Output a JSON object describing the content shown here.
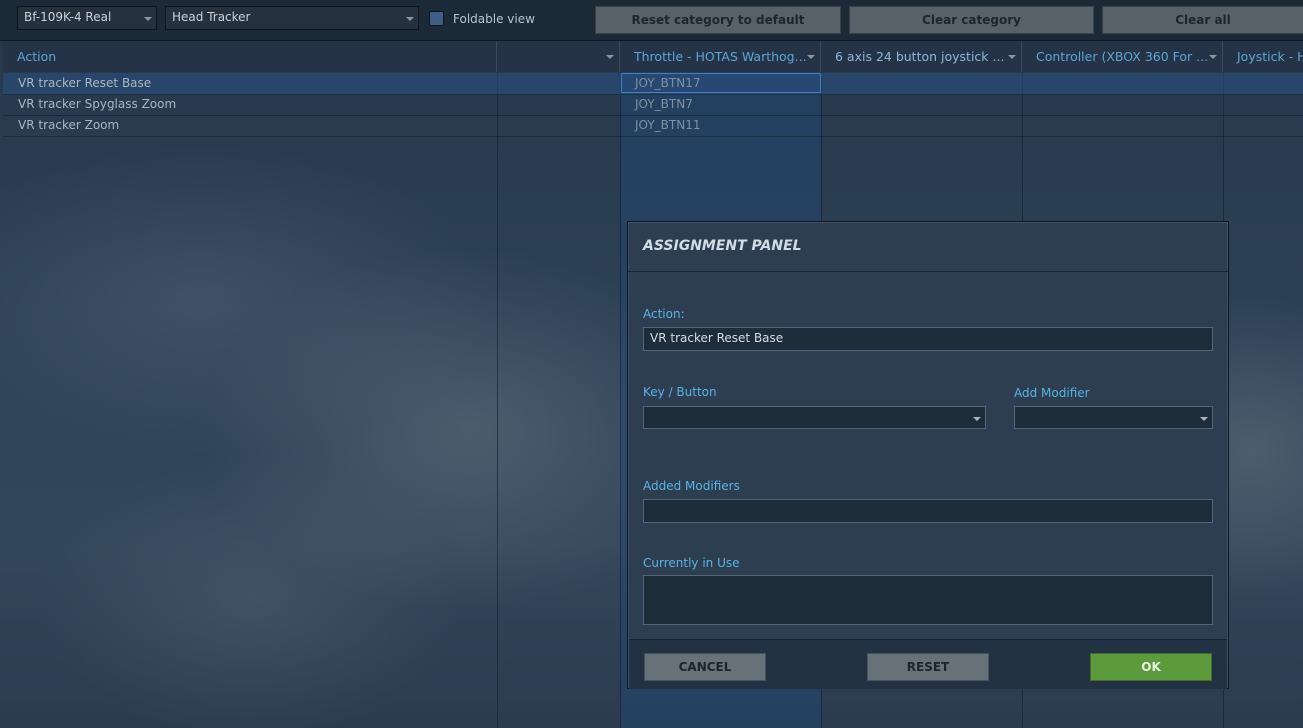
{
  "toolbar": {
    "aircraft_select": "Bf-109K-4 Real",
    "category_select": "Head Tracker",
    "foldable_label": "Foldable view",
    "reset_category_label": "Reset category to default",
    "clear_category_label": "Clear category",
    "clear_all_label": "Clear all"
  },
  "table": {
    "columns": [
      "Action",
      "",
      "Throttle - HOTAS Warthog...",
      "6 axis 24 button joystick ...",
      "Controller (XBOX 360 For ...",
      "Joystick - H"
    ],
    "rows": [
      {
        "action": "VR tracker Reset Base",
        "binding": "JOY_BTN17"
      },
      {
        "action": "VR tracker Spyglass Zoom",
        "binding": "JOY_BTN7"
      },
      {
        "action": "VR tracker Zoom",
        "binding": "JOY_BTN11"
      }
    ]
  },
  "assignment_panel": {
    "title": "ASSIGNMENT PANEL",
    "action_label": "Action:",
    "action_value": "VR tracker Reset Base",
    "key_button_label": "Key / Button",
    "key_button_value": "",
    "add_modifier_label": "Add Modifier",
    "add_modifier_value": "",
    "added_modifiers_label": "Added Modifiers",
    "added_modifiers_value": "",
    "currently_in_use_label": "Currently in Use",
    "currently_in_use_value": "",
    "cancel_label": "CANCEL",
    "reset_label": "RESET",
    "ok_label": "OK"
  },
  "colors": {
    "accent_text": "#5ab3e6",
    "ok_button": "#5c9a3c",
    "header_text": "#5aa6d6"
  }
}
